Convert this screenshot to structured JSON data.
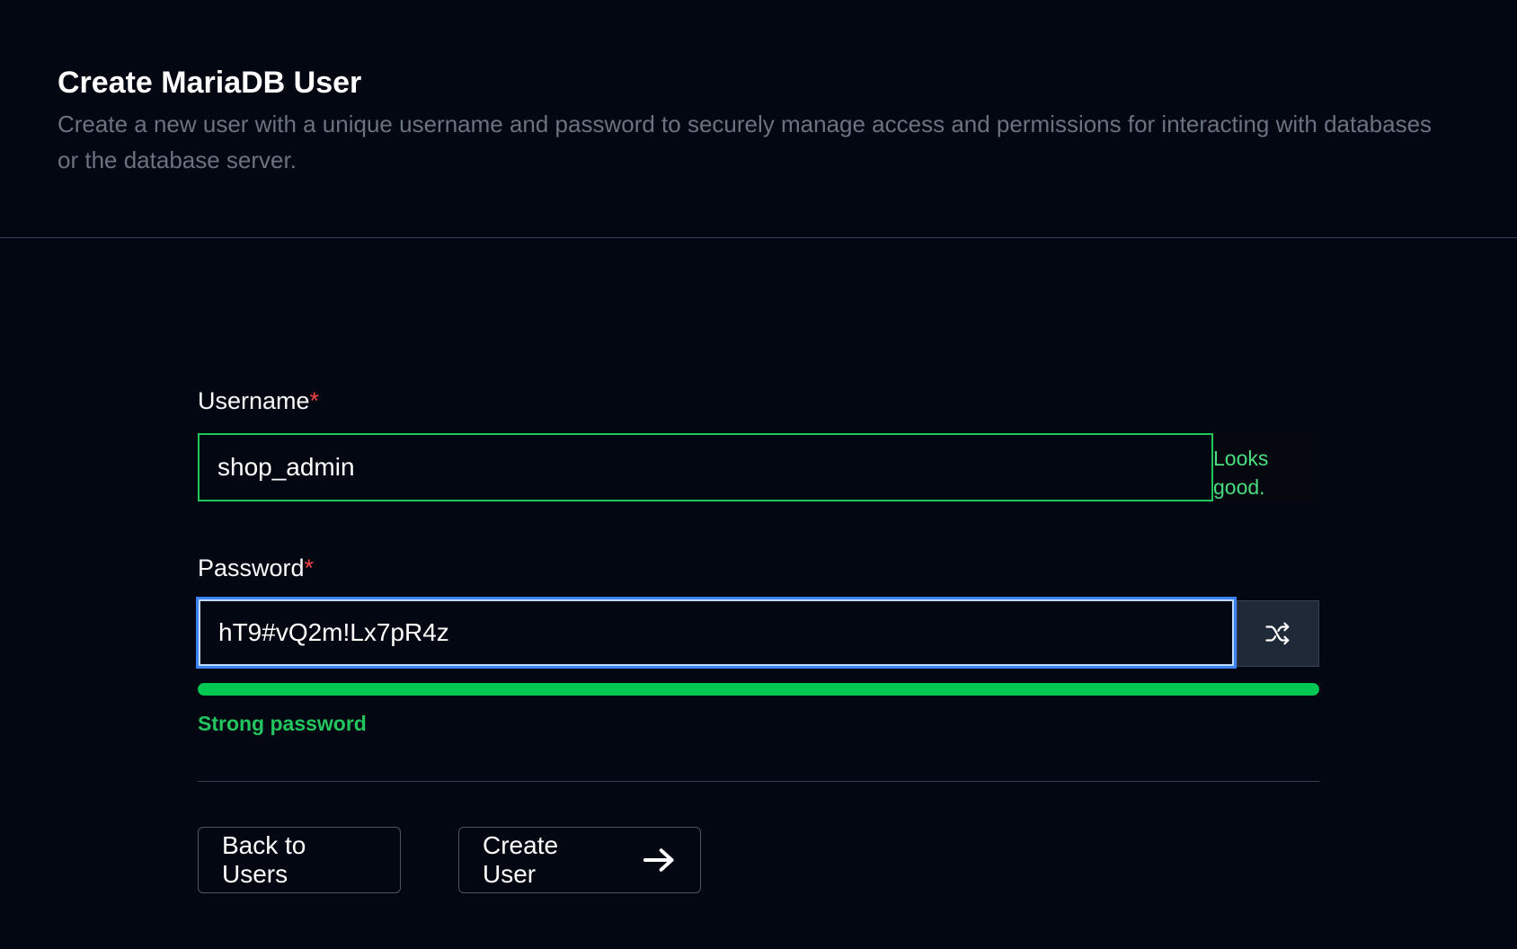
{
  "header": {
    "title": "Create MariaDB User",
    "subtitle": "Create a new user with a unique username and password to securely manage access and permissions for interacting with databases or the database server."
  },
  "form": {
    "username": {
      "label": "Username",
      "required_mark": "*",
      "value": "shop_admin",
      "feedback": "Looks good."
    },
    "password": {
      "label": "Password",
      "required_mark": "*",
      "value": "hT9#vQ2m!Lx7pR4z",
      "shuffle_icon": "shuffle-icon",
      "strength_fraction": 1.0,
      "strength_text": "Strong password"
    }
  },
  "actions": {
    "back_label": "Back to Users",
    "create_label": "Create User",
    "create_icon": "arrow-right-icon"
  },
  "colors": {
    "background": "#030712",
    "success": "#22c55e",
    "strength_fill": "#00c853",
    "focus_border": "#3b82f6",
    "required": "#ef4444",
    "muted_text": "#6b7280"
  }
}
